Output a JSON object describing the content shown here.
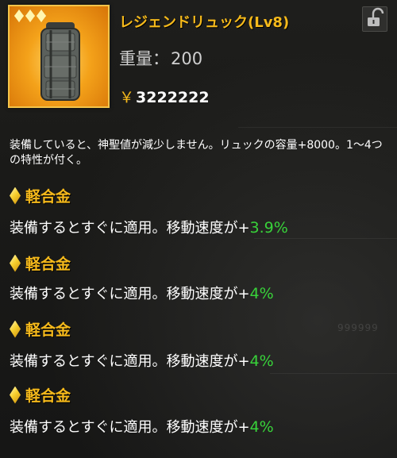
{
  "item": {
    "name": "レジェンドリュック(Lv8)",
    "rarity_icon": "diamond-icon",
    "rarity_count": 3,
    "image": "backpack-icon",
    "weight_label": "重量：",
    "weight_value": "200",
    "currency_symbol": "￥",
    "price": "3222222",
    "description": "装備していると、神聖値が減少しません。リュックの容量+8000。1～4つの特性が付く。",
    "lock_icon": "lock-open-icon"
  },
  "traits": [
    {
      "name": "軽合金",
      "effect_prefix": "装備するとすぐに適用。移動速度が+",
      "effect_value": "3.9%"
    },
    {
      "name": "軽合金",
      "effect_prefix": "装備するとすぐに適用。移動速度が+",
      "effect_value": "4%"
    },
    {
      "name": "軽合金",
      "effect_prefix": "装備するとすぐに適用。移動速度が+",
      "effect_value": "4%"
    },
    {
      "name": "軽合金",
      "effect_prefix": "装備するとすぐに適用。移動速度が+",
      "effect_value": "4%"
    }
  ],
  "background_text": "999999",
  "colors": {
    "title": "#f5b91b",
    "effect_value": "#38d33a",
    "frame": "#f3c44a"
  }
}
